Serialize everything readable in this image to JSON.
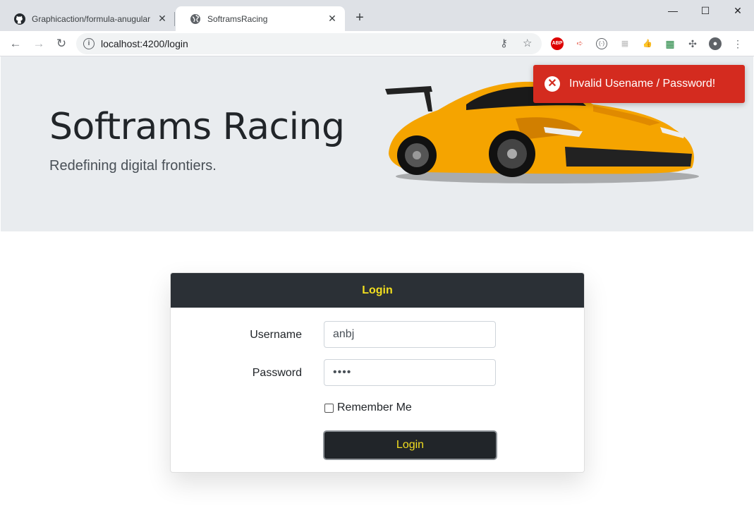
{
  "browser": {
    "tabs": [
      {
        "label": "Graphicaction/formula-anugular",
        "icon": "github-icon",
        "active": false
      },
      {
        "label": "SoftramsRacing",
        "icon": "globe-icon",
        "active": true
      }
    ],
    "new_tab": "+",
    "address": "localhost:4200/login",
    "window_controls": {
      "minimize": "—",
      "maximize": "☐",
      "close": "✕"
    }
  },
  "hero": {
    "title": "Softrams Racing",
    "subtitle": "Redefining digital frontiers.",
    "car_color": "#f5a400"
  },
  "toast": {
    "message": "Invalid Usename / Password!",
    "icon": "error-x-icon",
    "color": "#d42b1f"
  },
  "login": {
    "header": "Login",
    "username_label": "Username",
    "username_value": "anbj",
    "password_label": "Password",
    "password_value": "••••",
    "remember_label": "Remember Me",
    "remember_checked": false,
    "submit_label": "Login",
    "accent": "#f2de1f"
  }
}
